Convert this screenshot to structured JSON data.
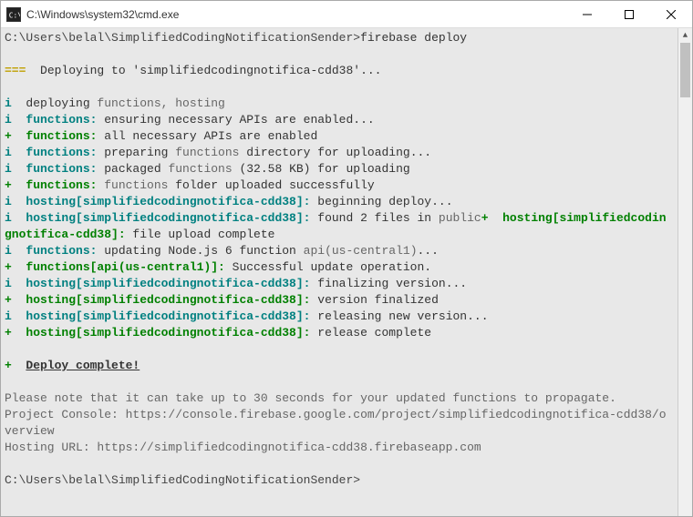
{
  "window": {
    "title": "C:\\Windows\\system32\\cmd.exe"
  },
  "console": {
    "prompt1": "C:\\Users\\belal\\SimplifiedCodingNotificationSender>",
    "cmd1": "firebase deploy",
    "deploy_prefix": "=== ",
    "deploy_msg": " Deploying to 'simplifiedcodingnotifica-cdd38'...",
    "l1_pre": "i  ",
    "l1_a": "deploying ",
    "l1_b": "functions, hosting",
    "l2_pre": "i  ",
    "l2_a": "functions:",
    "l2_b": " ensuring necessary APIs are enabled...",
    "l3_pre": "+  ",
    "l3_a": "functions:",
    "l3_b": " all necessary APIs are enabled",
    "l4_pre": "i  ",
    "l4_a": "functions:",
    "l4_b": " preparing ",
    "l4_c": "functions",
    "l4_d": " directory for uploading...",
    "l5_pre": "i  ",
    "l5_a": "functions:",
    "l5_b": " packaged ",
    "l5_c": "functions",
    "l5_d": " (32.58 KB) for uploading",
    "l6_pre": "+  ",
    "l6_a": "functions:",
    "l6_b": " ",
    "l6_c": "functions",
    "l6_d": " folder uploaded successfully",
    "l7_pre": "i  ",
    "l7_a": "hosting[simplifiedcodingnotifica-cdd38]:",
    "l7_b": " beginning deploy...",
    "l8_pre": "i  ",
    "l8_a": "hosting[simplifiedcodingnotifica-cdd38]:",
    "l8_b": " found 2 files in ",
    "l8_c": "public",
    "l8_d": "+  ",
    "l8_e": "hosting[simplifiedcodingnotifica-cdd38]:",
    "l8_f": " file upload complete",
    "l9_pre": "i  ",
    "l9_a": "functions:",
    "l9_b": " updating Node.js 6 function ",
    "l9_c": "api(us-central1)",
    "l9_d": "...",
    "l10_pre": "+  ",
    "l10_a": "functions[api(us-central1)]:",
    "l10_b": " Successful update operation.",
    "l11_pre": "i  ",
    "l11_a": "hosting[simplifiedcodingnotifica-cdd38]:",
    "l11_b": " finalizing version...",
    "l12_pre": "+  ",
    "l12_a": "hosting[simplifiedcodingnotifica-cdd38]:",
    "l12_b": " version finalized",
    "l13_pre": "i  ",
    "l13_a": "hosting[simplifiedcodingnotifica-cdd38]:",
    "l13_b": " releasing new version...",
    "l14_pre": "+  ",
    "l14_a": "hosting[simplifiedcodingnotifica-cdd38]:",
    "l14_b": " release complete",
    "dc_pre": "+  ",
    "dc_txt": "Deploy complete!",
    "note": "Please note that it can take up to 30 seconds for your updated functions to propagate.",
    "pc_label": "Project Console: ",
    "pc_url": "https://console.firebase.google.com/project/simplifiedcodingnotifica-cdd38/overview",
    "hu_label": "Hosting URL: ",
    "hu_url": "https://simplifiedcodingnotifica-cdd38.firebaseapp.com",
    "prompt2": "C:\\Users\\belal\\SimplifiedCodingNotificationSender>"
  }
}
